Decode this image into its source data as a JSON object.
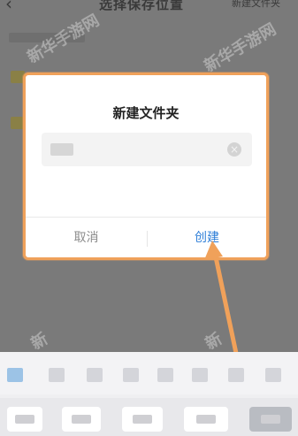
{
  "header": {
    "back_icon": "back-chevron-icon",
    "title": "选择保存位置",
    "new_folder": "新建文件夹"
  },
  "dialog": {
    "title": "新建文件夹",
    "input_value": "",
    "clear_icon": "clear-circle-icon",
    "cancel_label": "取消",
    "create_label": "创建"
  },
  "annotation": {
    "color": "#f0a15a",
    "arrow_icon": "pointer-arrow-icon"
  },
  "watermarks": [
    "新华手游网",
    "新华手游网",
    "新",
    "新"
  ],
  "colors": {
    "accent_blue": "#2f7fd8",
    "highlight_orange": "#f0a15a",
    "overlay": "#7a7a7a"
  }
}
